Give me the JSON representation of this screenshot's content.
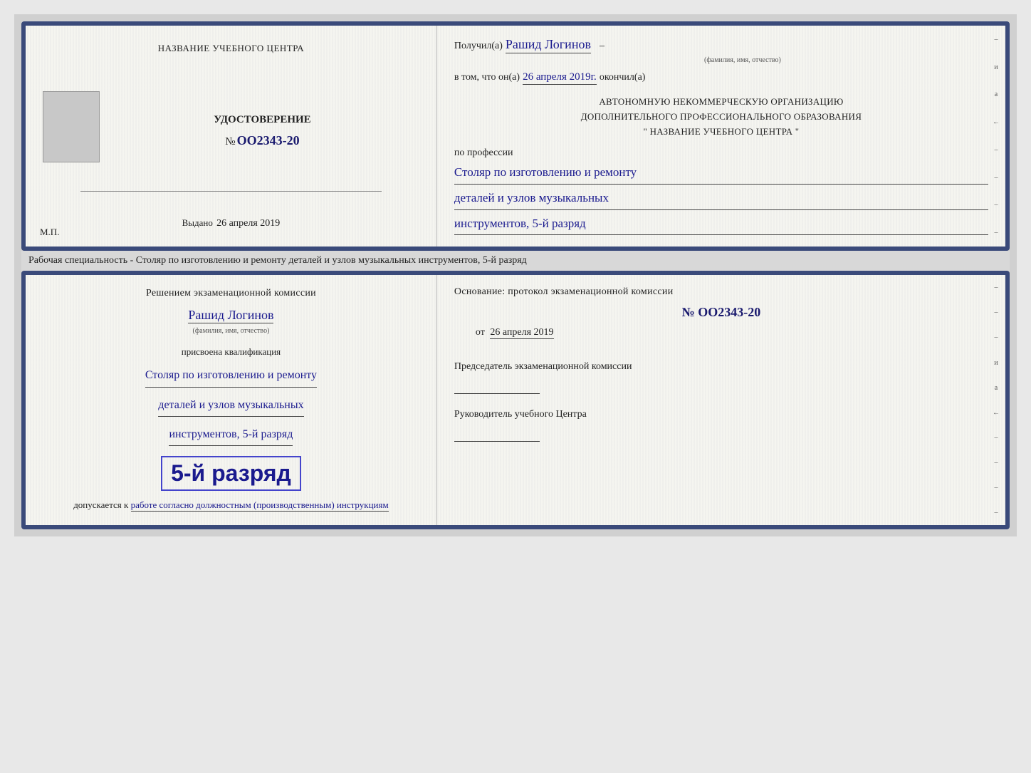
{
  "top_card": {
    "left": {
      "institution_name": "НАЗВАНИЕ УЧЕБНОГО ЦЕНТРА",
      "certificate_title": "УДОСТОВЕРЕНИЕ",
      "certificate_number_prefix": "№",
      "certificate_number": "OO2343-20",
      "issued_label": "Выдано",
      "issued_date": "26 апреля 2019",
      "mp_label": "М.П."
    },
    "right": {
      "recipient_prefix": "Получил(а)",
      "recipient_name": "Рашид Логинов",
      "fio_subtitle": "(фамилия, имя, отчество)",
      "vtom_prefix": "в том, что он(а)",
      "vtom_date": "26 апреля 2019г.",
      "okончил": "окончил(а)",
      "org_line1": "АВТОНОМНУЮ НЕКОММЕРЧЕСКУЮ ОРГАНИЗАЦИЮ",
      "org_line2": "ДОПОЛНИТЕЛЬНОГО ПРОФЕССИОНАЛЬНОГО ОБРАЗОВАНИЯ",
      "org_line3": "\"  НАЗВАНИЕ УЧЕБНОГО ЦЕНТРА  \"",
      "po_professii": "по профессии",
      "profession_line1": "Столяр по изготовлению и ремонту",
      "profession_line2": "деталей и узлов музыкальных",
      "profession_line3": "инструментов, 5-й разряд"
    }
  },
  "specialty_label": "Рабочая специальность - Столяр по изготовлению и ремонту деталей и узлов музыкальных инструментов, 5-й разряд",
  "bottom_card": {
    "left": {
      "resheniem": "Решением экзаменационной комиссии",
      "person_name": "Рашид Логинов",
      "fio_subtitle": "(фамилия, имя, отчество)",
      "prisvoena": "присвоена квалификация",
      "qualification_line1": "Столяр по изготовлению и ремонту",
      "qualification_line2": "деталей и узлов музыкальных",
      "qualification_line3": "инструментов, 5-й разряд",
      "big_rank": "5-й разряд",
      "dopuskaetsya": "допускается к",
      "work_type": "работе согласно должностным (производственным) инструкциям"
    },
    "right": {
      "osnovanie": "Основание: протокол экзаменационной комиссии",
      "number_prefix": "№",
      "number": "OO2343-20",
      "from_prefix": "от",
      "from_date": "26 апреля 2019",
      "predsedatel_label": "Председатель экзаменационной комиссии",
      "rukovoditel_label": "Руководитель учебного Центра"
    }
  },
  "right_edge_labels": [
    "и",
    "а",
    "←",
    "–",
    "–",
    "–",
    "–",
    "–"
  ]
}
